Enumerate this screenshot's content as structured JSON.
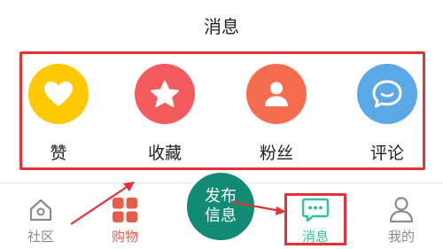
{
  "header": {
    "title": "消息"
  },
  "actions": [
    {
      "label": "赞",
      "icon": "heart-icon",
      "color": "#ffc800"
    },
    {
      "label": "收藏",
      "icon": "star-icon",
      "color": "#f45b5e"
    },
    {
      "label": "粉丝",
      "icon": "user-icon",
      "color": "#f56c4e"
    },
    {
      "label": "评论",
      "icon": "chat-bubble-icon",
      "color": "#5aa9e6"
    }
  ],
  "bottom_nav": {
    "items": [
      {
        "label": "社区",
        "icon": "home-icon",
        "color": "#8a8a8a"
      },
      {
        "label": "购物",
        "icon": "grid-icon",
        "color": "#e85b4b"
      },
      {
        "label": "消息",
        "icon": "message-icon",
        "color": "#2ec2a2",
        "active": true
      },
      {
        "label": "我的",
        "icon": "profile-icon",
        "color": "#8a8a8a"
      }
    ],
    "publish": {
      "line1": "发布",
      "line2": "信息",
      "color": "#128b74"
    }
  },
  "annotation_color": "#e53238"
}
